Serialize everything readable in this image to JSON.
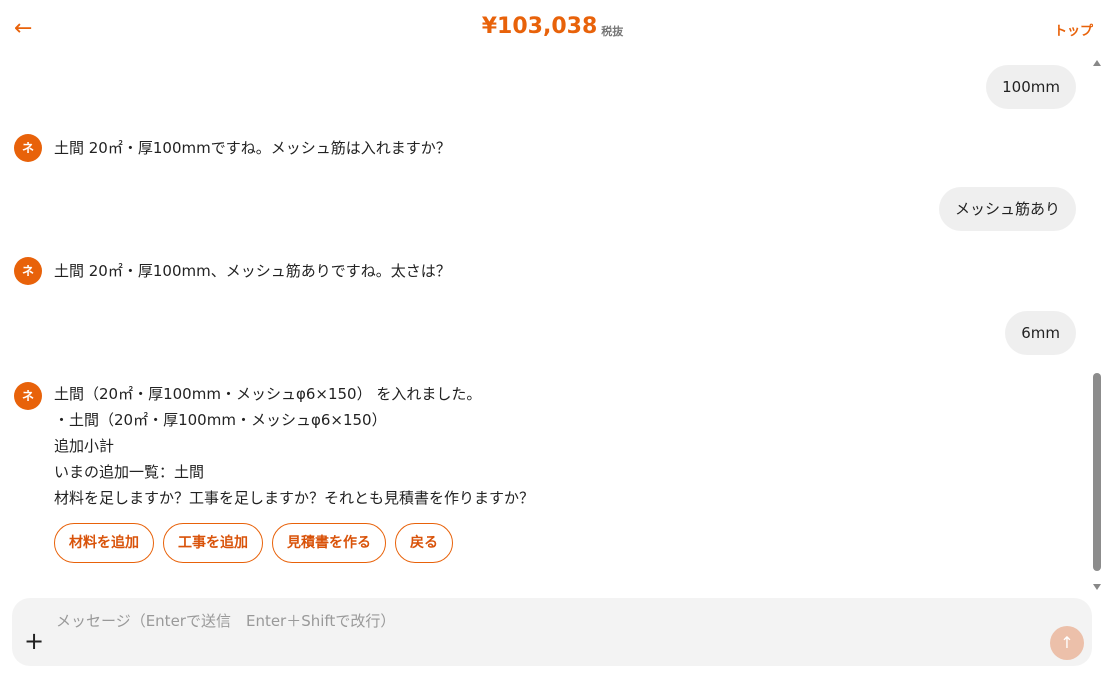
{
  "header": {
    "back_icon": "←",
    "price": "¥103,038",
    "tax_label": "税抜",
    "top_link": "トップ"
  },
  "messages": [
    {
      "role": "user",
      "text": "100mm"
    },
    {
      "role": "bot",
      "avatar": "ネ",
      "lines": [
        "土間 20㎡・厚100mmですね。メッシュ筋は入れますか？"
      ]
    },
    {
      "role": "user",
      "text": "メッシュ筋あり"
    },
    {
      "role": "bot",
      "avatar": "ネ",
      "lines": [
        "土間 20㎡・厚100mm、メッシュ筋ありですね。太さは？"
      ]
    },
    {
      "role": "user",
      "text": "6mm"
    },
    {
      "role": "bot",
      "avatar": "ネ",
      "lines": [
        "土間（20㎡・厚100mm・メッシュφ6×150） を入れました。",
        "・土間（20㎡・厚100mm・メッシュφ6×150）",
        "追加小計",
        "いまの追加一覧：土間",
        "材料を足しますか？工事を足しますか？それとも見積書を作りますか？"
      ]
    }
  ],
  "actions": {
    "add_material": "材料を追加",
    "add_work": "工事を追加",
    "make_estimate": "見積書を作る",
    "back": "戻る"
  },
  "composer": {
    "placeholder": "メッセージ（Enterで送信　Enter＋Shiftで改行）",
    "plus_icon": "+",
    "send_icon": "↑"
  },
  "colors": {
    "accent": "#e8620a",
    "bubble": "#efefef",
    "send_disabled": "#ecc0aa"
  }
}
